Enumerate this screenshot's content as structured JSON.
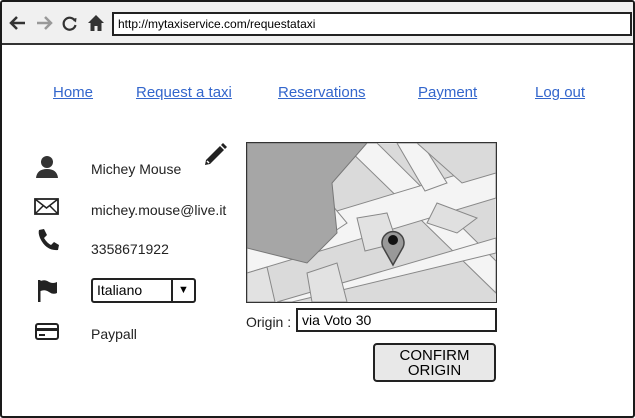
{
  "browser": {
    "url": "http://mytaxiservice.com/requestataxi",
    "icons": [
      "back-arrow-icon",
      "forward-arrow-icon",
      "reload-icon",
      "home-icon"
    ]
  },
  "nav": {
    "home": "Home",
    "request": "Request a taxi",
    "reservations": "Reservations",
    "payment": "Payment",
    "logout": "Log out"
  },
  "profile": {
    "name": "Michey Mouse",
    "email": "michey.mouse@live.it",
    "phone": "3358671922",
    "language": "Italiano",
    "payment_method": "Paypall"
  },
  "origin": {
    "label": "Origin :",
    "value": "via Voto 30"
  },
  "confirm": {
    "line1": "CONFIRM",
    "line2": "ORIGIN"
  },
  "colors": {
    "link": "#3366cc",
    "border": "#222222",
    "map_block": "#a6a6a6"
  }
}
